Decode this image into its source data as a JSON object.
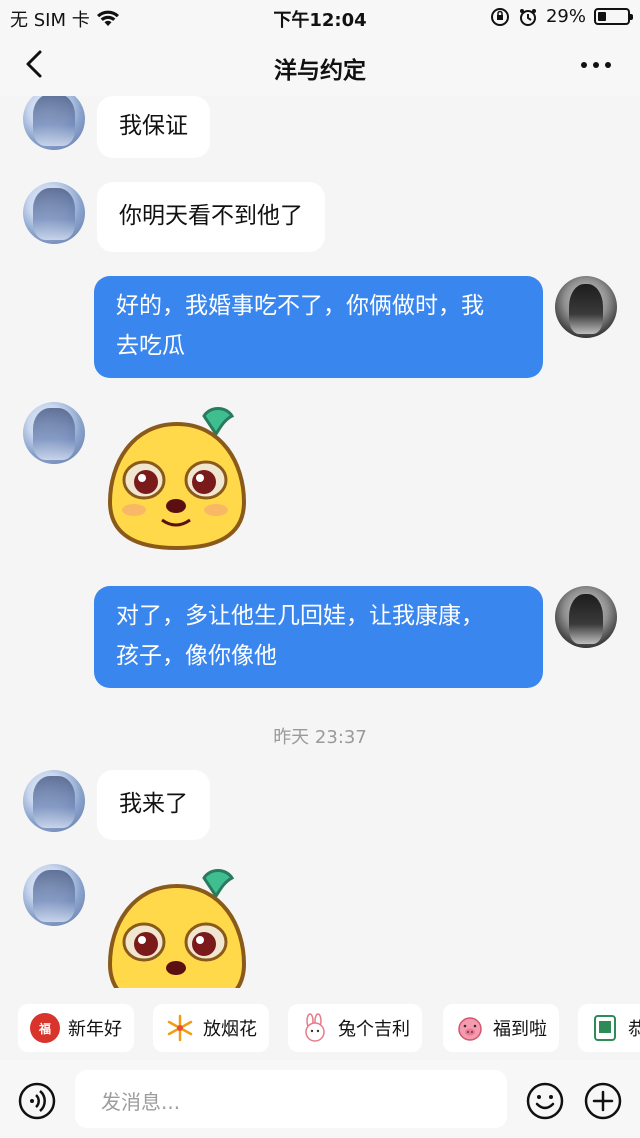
{
  "status_bar": {
    "carrier": "无 SIM 卡",
    "time": "下午12:04",
    "battery_percent": "29%",
    "battery_level": 0.29
  },
  "nav": {
    "title": "洋与约定"
  },
  "messages": [
    {
      "from": "peer",
      "type": "text",
      "text": "我保证"
    },
    {
      "from": "peer",
      "type": "text",
      "text": "你明天看不到他了"
    },
    {
      "from": "self",
      "type": "text",
      "line1": "好的，我婚事吃不了，你俩做时，我",
      "line2": "去吃瓜"
    },
    {
      "from": "peer",
      "type": "sticker",
      "sticker": "yellow-blob-dog-sticker"
    },
    {
      "from": "self",
      "type": "text",
      "line1": "对了，多让他生几回娃，让我康康，",
      "line2": "孩子，像你像他"
    },
    {
      "type": "timestamp",
      "text": "昨天 23:37"
    },
    {
      "from": "peer",
      "type": "text",
      "text": "我来了"
    },
    {
      "from": "peer",
      "type": "sticker",
      "sticker": "yellow-blob-dog-sticker"
    }
  ],
  "quick_replies": [
    {
      "label": "新年好",
      "icon": "red-envelope-icon"
    },
    {
      "label": "放烟花",
      "icon": "firework-icon"
    },
    {
      "label": "兔个吉利",
      "icon": "rabbit-icon"
    },
    {
      "label": "福到啦",
      "icon": "pig-icon"
    },
    {
      "label": "恭",
      "icon": "mahjong-icon"
    }
  ],
  "input": {
    "placeholder": "发消息..."
  },
  "colors": {
    "accent_blue": "#3a86ef",
    "background": "#f5f5f5"
  }
}
